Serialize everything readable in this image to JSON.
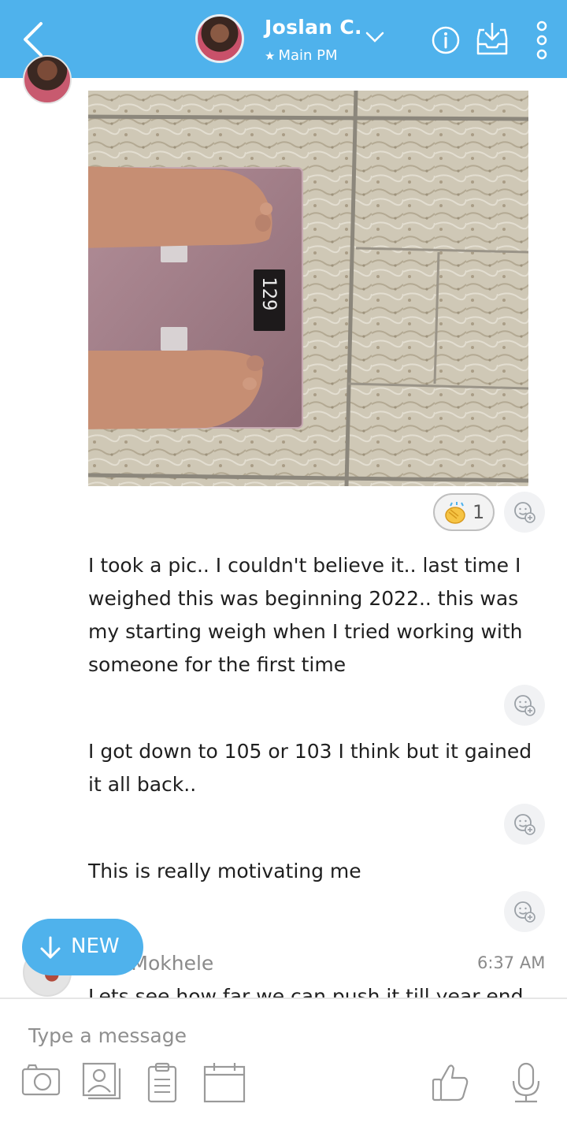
{
  "header": {
    "name": "Joslan C.",
    "subtitle": "Main PM",
    "back_icon": "chevron-left-icon",
    "info_icon": "info-icon",
    "inbox_icon": "inbox-download-icon",
    "more_icon": "vertical-dots-icon",
    "bg_color": "#4fb2ec"
  },
  "photo": {
    "scale_display": "129"
  },
  "reaction": {
    "emoji": "clapping-hands",
    "count": "1"
  },
  "messages": [
    {
      "text": "I took a pic.. I couldn't believe it.. last time I weighed this was beginning 2022.. this was my starting weigh when I tried working with someone for the first time"
    },
    {
      "text": "I got down to 105 or 103 I think but it gained it all back.."
    },
    {
      "text": "This is really motivating me"
    }
  ],
  "new_button": {
    "label": "NEW"
  },
  "next_message": {
    "sender": "Thapano Mokhele",
    "sender_visible": "ano Mokhele",
    "time": "6:37 AM",
    "text": "Lets see how far we can push it till year end"
  },
  "composer": {
    "placeholder": "Type a message",
    "tools": [
      "camera-icon",
      "contact-card-icon",
      "clipboard-icon",
      "calendar-icon",
      "thumbs-up-icon",
      "microphone-icon"
    ]
  }
}
